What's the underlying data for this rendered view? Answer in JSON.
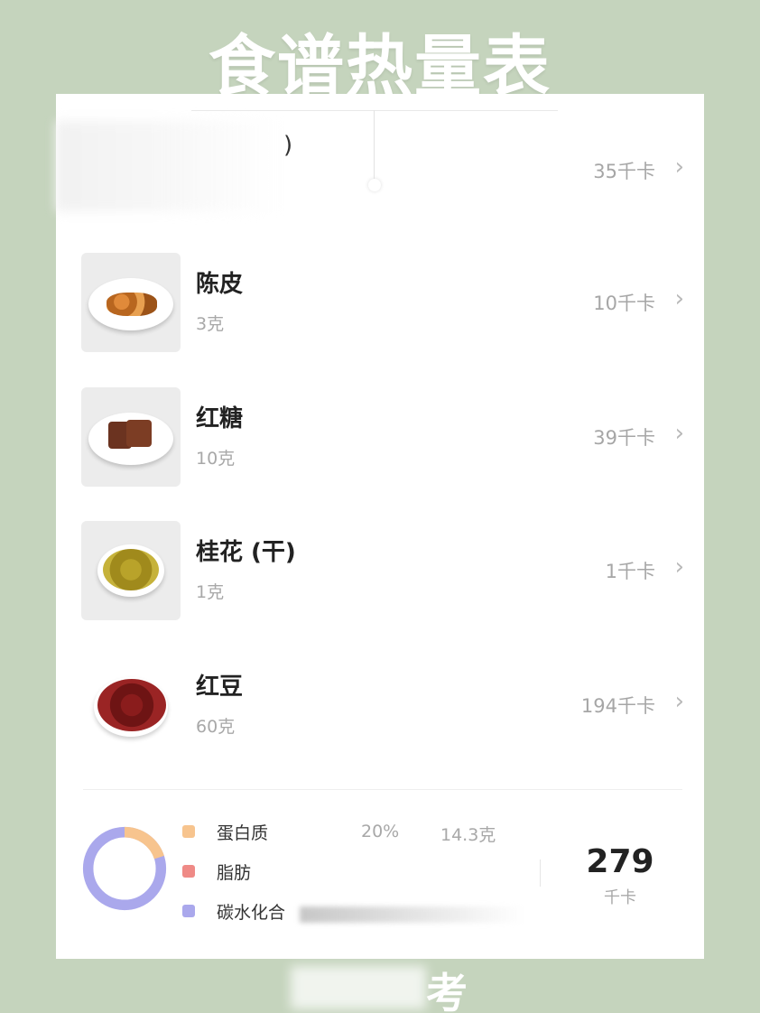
{
  "header": {
    "title": "食谱热量表"
  },
  "top_row": {
    "kcal": "35千卡"
  },
  "ingredients": [
    {
      "name": "陈皮",
      "weight": "3克",
      "kcal": "10千卡",
      "icon": "dried-tangerine-peel-icon"
    },
    {
      "name": "红糖",
      "weight": "10克",
      "kcal": "39千卡",
      "icon": "brown-sugar-icon"
    },
    {
      "name": "桂花 (干)",
      "weight": "1克",
      "kcal": "1千卡",
      "icon": "dried-osmanthus-icon"
    },
    {
      "name": "红豆",
      "weight": "60克",
      "kcal": "194千卡",
      "icon": "red-bean-icon"
    }
  ],
  "summary": {
    "legend": [
      {
        "label": "蛋白质",
        "color": "#f7c48e"
      },
      {
        "label": "脂肪",
        "color": "#ef8a86"
      },
      {
        "label": "碳水化合",
        "color": "#aaa8ec"
      }
    ],
    "protein_pct": "20%",
    "protein_grams": "14.3克",
    "total": "279",
    "total_unit": "千卡",
    "protein_fraction": 0.2
  },
  "footer": {
    "visible_char": "考"
  },
  "chevron": "›"
}
